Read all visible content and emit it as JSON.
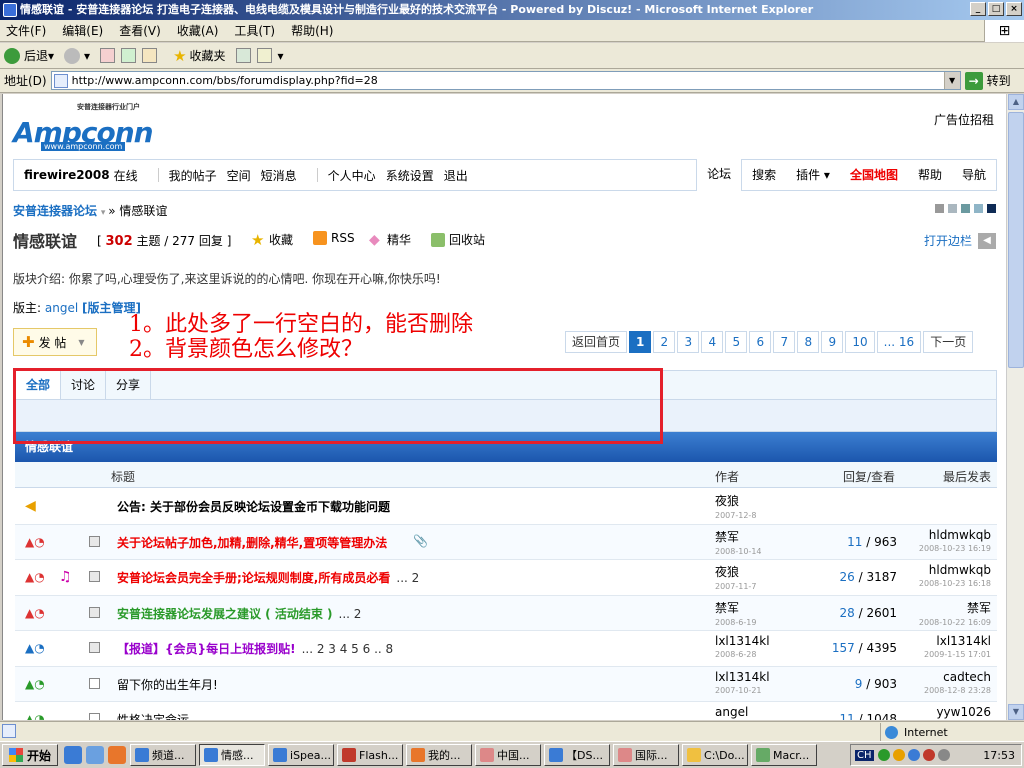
{
  "window": {
    "title": "情感联谊 - 安普连接器论坛 打造电子连接器、电线电缆及模具设计与制造行业最好的技术交流平台 - Powered by Discuz! - Microsoft Internet Explorer"
  },
  "menu": [
    "文件(F)",
    "编辑(E)",
    "查看(V)",
    "收藏(A)",
    "工具(T)",
    "帮助(H)"
  ],
  "toolbar": {
    "back": "后退",
    "favorites": "收藏夹"
  },
  "address": {
    "label": "地址(D)",
    "url": "http://www.ampconn.com/bbs/forumdisplay.php?fid=28",
    "go": "转到"
  },
  "site": {
    "tagline": "安普连接器行业门户",
    "wordmark": "Ampconn",
    "url": "www.ampconn.com",
    "ad": "广告位招租"
  },
  "nav": {
    "username": "firewire2008",
    "online": "在线",
    "links": [
      "我的帖子",
      "空间",
      "短消息"
    ],
    "links2": [
      "个人中心",
      "系统设置",
      "退出"
    ],
    "right": [
      "论坛",
      "搜索",
      "插件 ▾",
      "全国地图",
      "帮助",
      "导航"
    ]
  },
  "breadcrumb": {
    "home": "安普连接器论坛",
    "current": "情感联谊"
  },
  "swatch_colors": [
    "#999999",
    "#aab7bf",
    "#6b9aa0",
    "#8fb5c7",
    "#0e2b55"
  ],
  "forum": {
    "name": "情感联谊",
    "topics": "302",
    "topics_label": "主题",
    "replies": "277",
    "replies_label": "回复",
    "favorite": "收藏",
    "rss": "RSS",
    "digest": "精华",
    "recycle": "回收站",
    "sidebar": "打开边栏",
    "intro": "版块介绍: 你累了吗,心理受伤了,来这里诉说的的心情吧. 你现在开心嘛,你快乐吗!",
    "mods_label": "版主:",
    "mod": "angel",
    "mod_mgmt": "[版主管理]"
  },
  "post_button": "发 帖",
  "annotation": {
    "line1": "1。此处多了一行空白的，能否删除",
    "line2": "2。背景颜色怎么修改？"
  },
  "pager": {
    "prev": "返回首页",
    "pages": [
      "1",
      "2",
      "3",
      "4",
      "5",
      "6",
      "7",
      "8",
      "9",
      "10",
      "... 16"
    ],
    "next": "下一页"
  },
  "tabs": [
    "全部",
    "讨论",
    "分享"
  ],
  "forum_header": "情感联谊",
  "columns": {
    "title": "标题",
    "author": "作者",
    "replies": "回复/查看",
    "last": "最后发表"
  },
  "threads": [
    {
      "title": "公告: 关于部份会员反映论坛设置金币下载功能问题",
      "color": "#000",
      "author": "夜狼",
      "date": "2007-12-8",
      "replies": "",
      "views": "",
      "last_user": "",
      "last_date": "",
      "pages": ""
    },
    {
      "title": "关于论坛帖子加色,加精,删除,精华,置项等管理办法",
      "color": "#e00",
      "author": "禁军",
      "date": "2008-10-14",
      "replies": "11",
      "views": "963",
      "last_user": "hldmwkqb",
      "last_date": "2008-10-23 16:19",
      "pages": ""
    },
    {
      "title": "安普论坛会员完全手册;论坛规则制度,所有成员必看",
      "color": "#e00",
      "author": "夜狼",
      "date": "2007-11-7",
      "replies": "26",
      "views": "3187",
      "last_user": "hldmwkqb",
      "last_date": "2008-10-23 16:18",
      "pages": "... 2"
    },
    {
      "title": "安普连接器论坛发展之建议 ( 活动结束 )",
      "color": "#2a9a2a",
      "author": "禁军",
      "date": "2008-6-19",
      "replies": "28",
      "views": "2601",
      "last_user": "禁军",
      "last_date": "2008-10-22 16:09",
      "pages": "... 2"
    },
    {
      "title": "【报道】{会员}每日上班报到贴!",
      "color": "#90c",
      "author": "lxl1314kl",
      "date": "2008-6-28",
      "replies": "157",
      "views": "4395",
      "last_user": "lxl1314kl",
      "last_date": "2009-1-15 17:01",
      "pages": "... 2 3 4 5 6 .. 8"
    },
    {
      "title": "留下你的出生年月!",
      "color": "#000",
      "author": "lxl1314kl",
      "date": "2007-10-21",
      "replies": "9",
      "views": "903",
      "last_user": "cadtech",
      "last_date": "2008-12-8 23:28",
      "pages": ""
    },
    {
      "title": "性格决定命运",
      "color": "#000",
      "author": "angel",
      "date": "",
      "replies": "11",
      "views": "1048",
      "last_user": "yyw1026",
      "last_date": "",
      "pages": ""
    }
  ],
  "status": {
    "zone": "Internet"
  },
  "taskbar": {
    "start": "开始",
    "tasks": [
      "频道...",
      "情感...",
      "iSpea...",
      "Flash...",
      "我的...",
      "中国...",
      "【DS...",
      "国际...",
      "C:\\Do...",
      "Macr..."
    ],
    "lang": "CH",
    "clock": "17:53"
  }
}
